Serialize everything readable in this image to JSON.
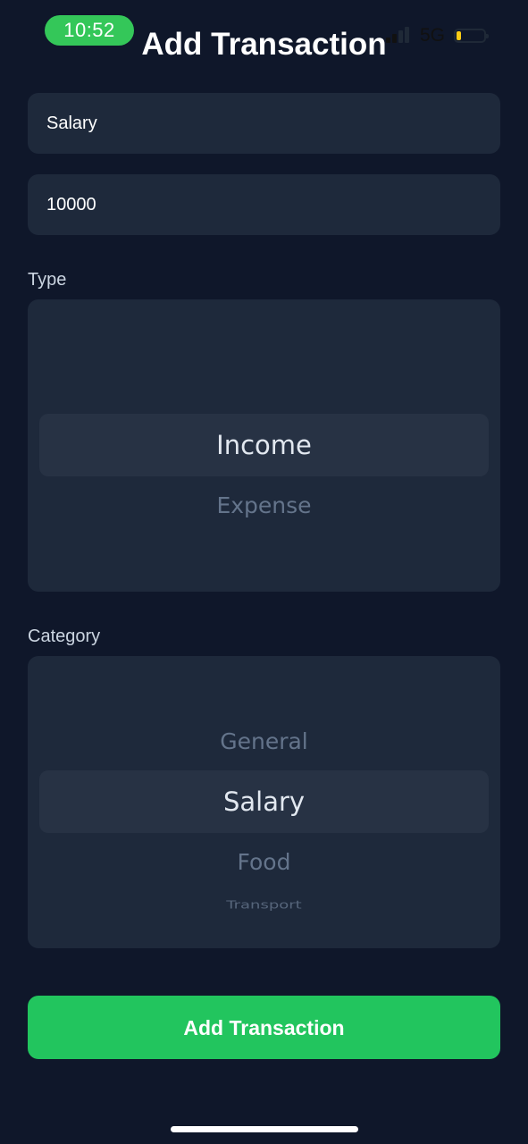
{
  "status_bar": {
    "time": "10:52",
    "network": "5G",
    "battery_level": 0.15,
    "battery_color": "#facc15",
    "pill_color": "#34c759"
  },
  "header": {
    "title": "Add Transaction"
  },
  "form": {
    "title_value": "Salary",
    "amount_value": "10000",
    "type_label": "Type",
    "type_options": [
      "Income",
      "Expense"
    ],
    "type_selected": "Income",
    "category_label": "Category",
    "category_options": [
      "General",
      "Salary",
      "Food",
      "Transport"
    ],
    "category_selected": "Salary",
    "submit_label": "Add Transaction",
    "submit_color": "#22c55e"
  },
  "theme": {
    "background": "#0f172a",
    "surface": "#1e293b"
  }
}
